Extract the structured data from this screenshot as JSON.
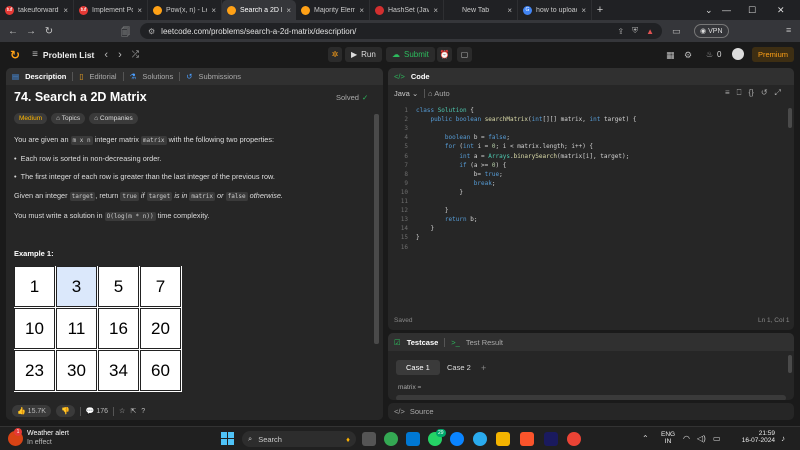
{
  "tabs": [
    {
      "label": "takeuforward - Be",
      "fav": "#e53935",
      "favtext": "tuf"
    },
    {
      "label": "Implement Pow(x,",
      "fav": "#e53935",
      "favtext": "tuf"
    },
    {
      "label": "Pow(x, n) - LeetCo",
      "fav": "#ffa116",
      "favtext": ""
    },
    {
      "label": "Search a 2D M",
      "fav": "#ffa116",
      "favtext": "",
      "active": true
    },
    {
      "label": "Majority Elemen",
      "fav": "#ffa116",
      "favtext": ""
    },
    {
      "label": "HashSet (Java Plat",
      "fav": "#d32f2f",
      "favtext": ""
    },
    {
      "label": "New Tab",
      "fav": "",
      "favtext": ""
    },
    {
      "label": "how to upload en",
      "fav": "#4285f4",
      "favtext": "G"
    }
  ],
  "url": "leetcode.com/problems/search-a-2d-matrix/description/",
  "vpn_label": "VPN",
  "nav": {
    "problem_list": "Problem List",
    "run": "Run",
    "submit": "Submit",
    "fire_count": "0",
    "premium": "Premium"
  },
  "left_tabs": {
    "description": "Description",
    "editorial": "Editorial",
    "solutions": "Solutions",
    "submissions": "Submissions"
  },
  "problem": {
    "title": "74. Search a 2D Matrix",
    "status": "Solved",
    "difficulty": "Medium",
    "topics": "Topics",
    "companies": "Companies",
    "p1a": "You are given an",
    "p1code1": "m x n",
    "p1b": "integer matrix",
    "p1code2": "matrix",
    "p1c": "with the following two properties:",
    "bullet1": "Each row is sorted in non-decreasing order.",
    "bullet2": "The first integer of each row is greater than the last integer of the previous row.",
    "p2a": "Given an integer",
    "p2code1": "target",
    "p2b": ", return",
    "p2code2": "true",
    "p2c": "if",
    "p2code3": "target",
    "p2d": "is in",
    "p2code4": "matrix",
    "p2e": "or",
    "p2code5": "false",
    "p2f": "otherwise.",
    "p3a": "You must write a solution in",
    "p3code": "O(log(m * n))",
    "p3b": "time complexity.",
    "example_label": "Example 1:",
    "matrix": [
      [
        "1",
        "3",
        "5",
        "7"
      ],
      [
        "10",
        "11",
        "16",
        "20"
      ],
      [
        "23",
        "30",
        "34",
        "60"
      ]
    ]
  },
  "footer": {
    "likes": "15.7K",
    "comments": "176"
  },
  "code_panel": {
    "title": "Code",
    "language": "Java",
    "auto": "Auto",
    "saved": "Saved",
    "cursor": "Ln 1, Col 1",
    "lines": [
      {
        "n": "1",
        "t": "class Solution {"
      },
      {
        "n": "2",
        "t": "    public boolean searchMatrix(int[][] matrix, int target) {"
      },
      {
        "n": "3",
        "t": ""
      },
      {
        "n": "4",
        "t": "        boolean b = false;"
      },
      {
        "n": "5",
        "t": "        for (int i = 0; i < matrix.length; i++) {"
      },
      {
        "n": "6",
        "t": "            int a = Arrays.binarySearch(matrix[i], target);"
      },
      {
        "n": "7",
        "t": "            if (a >= 0) {"
      },
      {
        "n": "8",
        "t": "                b= true;"
      },
      {
        "n": "9",
        "t": "                break;"
      },
      {
        "n": "10",
        "t": "            }"
      },
      {
        "n": "11",
        "t": ""
      },
      {
        "n": "12",
        "t": "        }"
      },
      {
        "n": "13",
        "t": "        return b;"
      },
      {
        "n": "14",
        "t": "    }"
      },
      {
        "n": "15",
        "t": "}"
      },
      {
        "n": "16",
        "t": ""
      }
    ]
  },
  "testcase": {
    "tab": "Testcase",
    "result_tab": "Test Result",
    "case1": "Case 1",
    "case2": "Case 2",
    "add": "+",
    "matrix_label": "matrix ="
  },
  "source_label": "Source",
  "taskbar": {
    "weather_title": "Weather alert",
    "weather_sub": "In effect",
    "weather_badge": "1",
    "search": "Search",
    "badge": "29",
    "lang1": "ENG",
    "lang2": "IN",
    "time": "21:59",
    "date": "16-07-2024"
  }
}
